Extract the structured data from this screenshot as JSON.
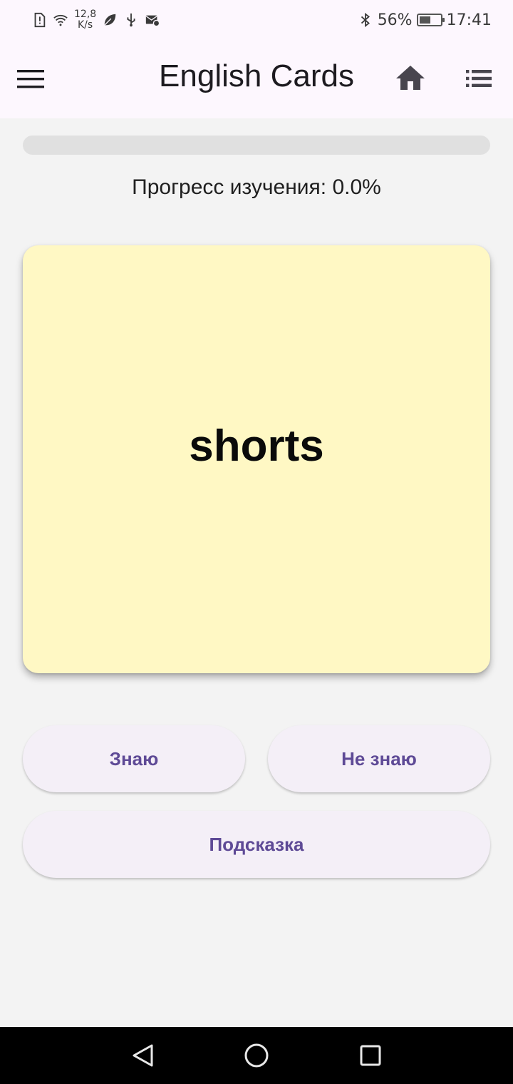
{
  "status_bar": {
    "network_speed": "12,8",
    "network_speed_unit": "K/s",
    "battery_percent": "56%",
    "battery_level": 0.56,
    "time": "17:41",
    "icons": [
      "sim-alert-icon",
      "wifi-icon",
      "leaf-icon",
      "usb-icon",
      "mail-settings-icon",
      "bluetooth-icon",
      "battery-icon"
    ]
  },
  "app_bar": {
    "title": "English Cards",
    "icons": [
      "menu-icon",
      "home-icon",
      "list-icon"
    ]
  },
  "progress": {
    "label": "Прогресс изучения: 0.0%",
    "value": 0.0
  },
  "card": {
    "word": "shorts",
    "background": "#fff8c4"
  },
  "buttons": {
    "know": "Знаю",
    "dont_know": "Не знаю",
    "hint": "Подсказка"
  },
  "nav_bar": {
    "icons": [
      "back-icon",
      "home-circle-icon",
      "recents-icon"
    ]
  },
  "colors": {
    "accent": "#6750a4",
    "button_text": "#5e4a96",
    "button_bg": "#f4eff7",
    "app_bar_bg": "#fdf7fe"
  }
}
